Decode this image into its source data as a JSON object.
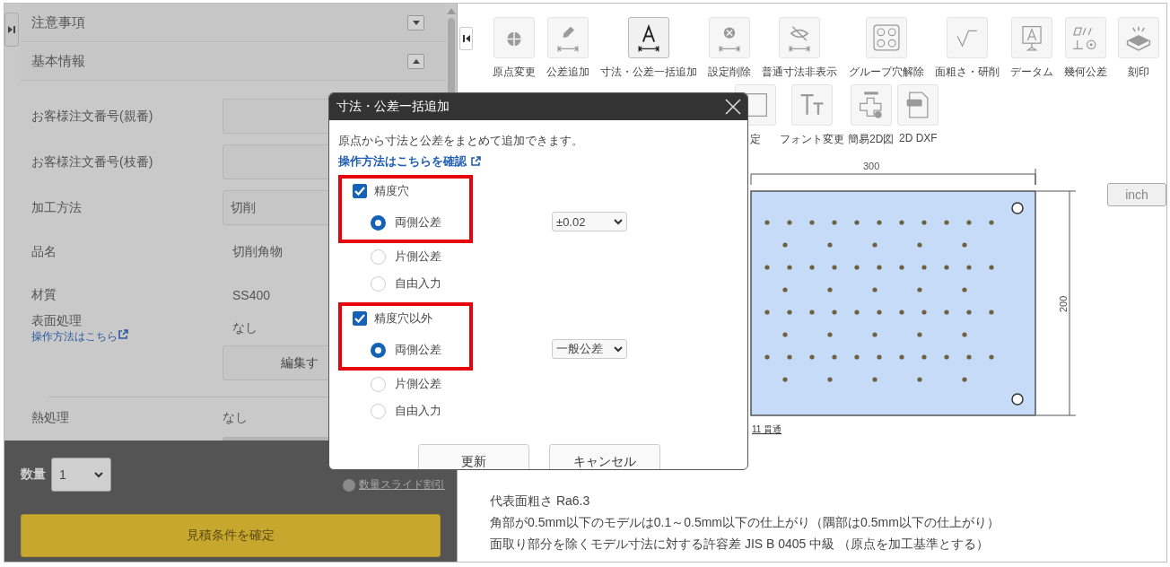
{
  "left_panel": {
    "sections": [
      {
        "title": "注意事項",
        "expanded": false
      },
      {
        "title": "基本情報",
        "expanded": true
      }
    ],
    "fields": [
      {
        "label": "お客様注文番号(親番)",
        "kind": "input"
      },
      {
        "label": "お客様注文番号(枝番)",
        "kind": "input"
      },
      {
        "label": "加工方法",
        "kind": "select",
        "value": "切削"
      },
      {
        "label": "品名",
        "kind": "text",
        "value": "切削角物"
      },
      {
        "label": "材質",
        "kind": "text",
        "value": "SS400"
      },
      {
        "label": "表面処理",
        "kind": "text",
        "value": "なし",
        "link": "操作方法はこちら"
      }
    ],
    "edit_button": "編集す",
    "heat_treatment": {
      "label": "熱処理",
      "value": "なし"
    },
    "footer": {
      "quantity_label": "数量",
      "quantity": "1",
      "discount_link": "数量スライド割引",
      "confirm_button": "見積条件を確定"
    }
  },
  "toolbar": {
    "row_1": [
      {
        "label": "原点変更",
        "selected": false
      },
      {
        "label": "公差追加",
        "selected": false
      },
      {
        "label": "寸法・公差一括追加",
        "selected": true
      },
      {
        "label": "設定削除",
        "selected": false
      },
      {
        "label": "普通寸法非表示",
        "selected": false
      },
      {
        "label": "グループ穴解除",
        "selected": false
      },
      {
        "label": "面粗さ・研削",
        "selected": false
      },
      {
        "label": "データム",
        "selected": false
      },
      {
        "label": "幾何公差",
        "selected": false
      },
      {
        "label": "刻印",
        "selected": false
      }
    ],
    "row_2": [
      {
        "label": "定",
        "selected": false
      },
      {
        "label": "フォント変更",
        "selected": false
      },
      {
        "label": "簡易2D図",
        "selected": false
      },
      {
        "label": "2D DXF",
        "selected": false
      }
    ]
  },
  "drawing": {
    "width_dimension": "300",
    "height_dimension": "200",
    "unit_button": "inch",
    "hole_note": "11 貫通"
  },
  "notes": [
    "代表面粗さ Ra6.3",
    "角部が0.5mm以下のモデルは0.1～0.5mm以下の仕上がり（隅部は0.5mm以下の仕上がり）",
    "面取り部分を除くモデル寸法に対する許容差 JIS B 0405 中級 （原点を加工基準とする）"
  ],
  "dialog": {
    "title": "寸法・公差一括追加",
    "description": "原点から寸法と公差をまとめて追加できます。",
    "help_link": "操作方法はこちらを確認",
    "groups": [
      {
        "label": "精度穴",
        "checked": true,
        "highlighted": true,
        "tolerance": "±0.02",
        "options": [
          {
            "label": "両側公差",
            "selected": true
          },
          {
            "label": "片側公差",
            "selected": false
          },
          {
            "label": "自由入力",
            "selected": false
          }
        ]
      },
      {
        "label": "精度穴以外",
        "checked": true,
        "highlighted": true,
        "tolerance": "一般公差",
        "options": [
          {
            "label": "両側公差",
            "selected": true
          },
          {
            "label": "片側公差",
            "selected": false
          },
          {
            "label": "自由入力",
            "selected": false
          }
        ]
      }
    ],
    "buttons": [
      "更新",
      "キャンセル"
    ]
  }
}
